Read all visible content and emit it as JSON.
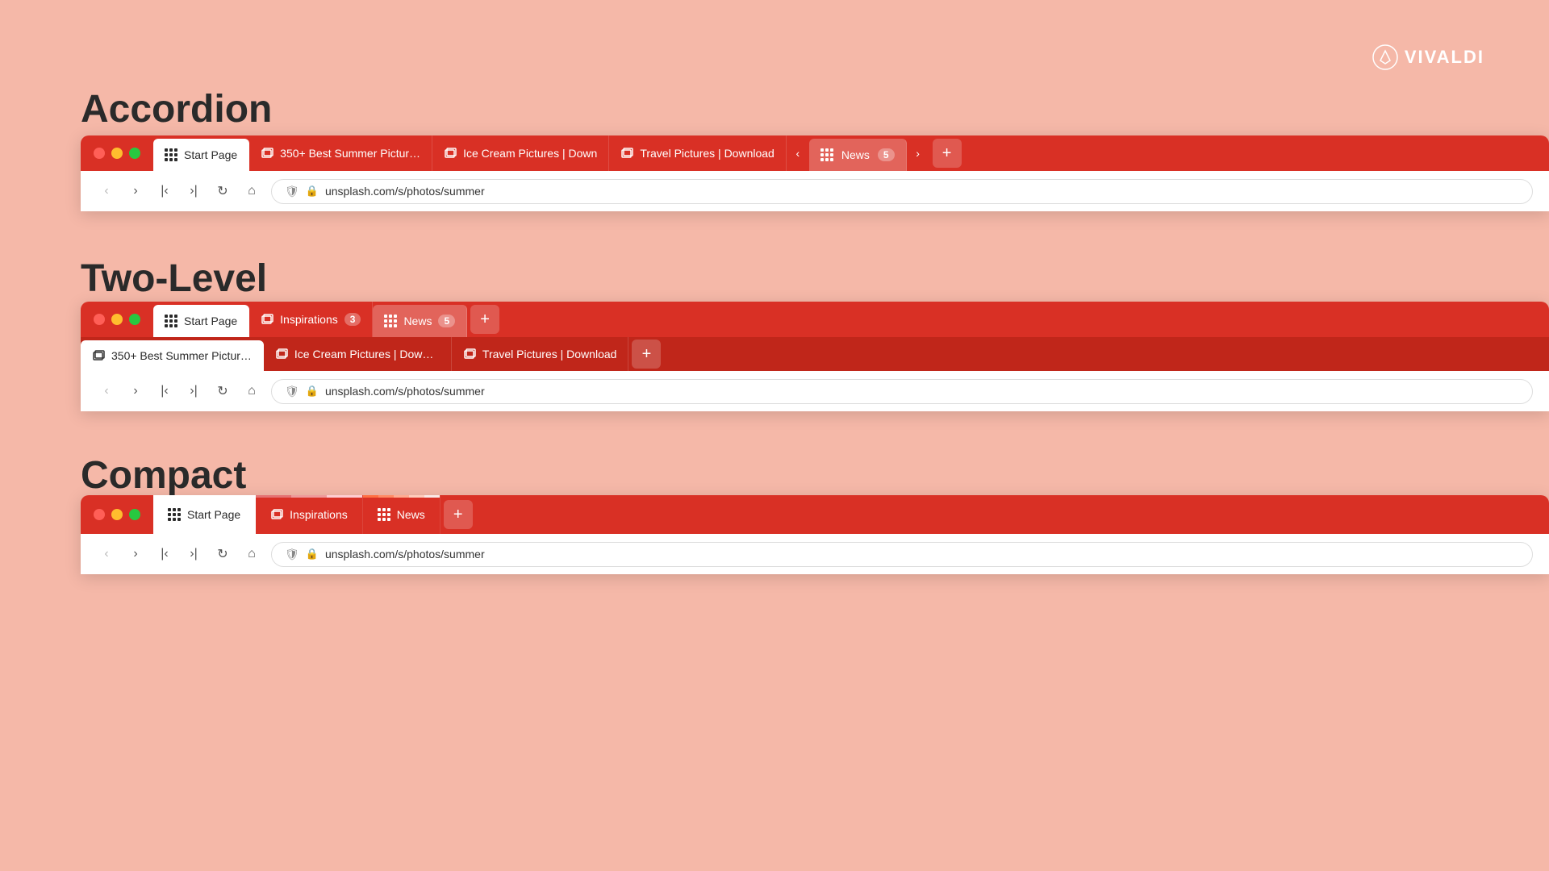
{
  "vivaldi": {
    "logo_text": "VIVALDI"
  },
  "sections": {
    "accordion": {
      "title": "Accordion",
      "tabs": [
        {
          "id": "start",
          "label": "Start Page",
          "type": "apps",
          "active": true
        },
        {
          "id": "summer",
          "label": "350+ Best Summer Pictur…",
          "type": "stack",
          "active": false
        },
        {
          "id": "icecream",
          "label": "Ice Cream Pictures | Down",
          "type": "stack",
          "active": false
        },
        {
          "id": "travel",
          "label": "Travel Pictures | Download",
          "type": "stack",
          "active": false
        }
      ],
      "group_tab": {
        "label": "News",
        "count": "5"
      },
      "url": "unsplash.com/s/photos/summer"
    },
    "twolevel": {
      "title": "Two-Level",
      "top_tabs": [
        {
          "id": "start",
          "label": "Start Page",
          "type": "apps"
        },
        {
          "id": "inspirations",
          "label": "Inspirations",
          "count": "3"
        },
        {
          "id": "news",
          "label": "News",
          "count": "5",
          "active": true
        }
      ],
      "sub_tabs": [
        {
          "id": "summer",
          "label": "350+ Best Summer Pictur…",
          "type": "stack",
          "active": true
        },
        {
          "id": "icecream",
          "label": "Ice Cream Pictures | Down…",
          "type": "stack"
        },
        {
          "id": "travel",
          "label": "Travel Pictures | Download",
          "type": "stack"
        }
      ],
      "url": "unsplash.com/s/photos/summer"
    },
    "compact": {
      "title": "Compact",
      "tabs": [
        {
          "id": "start",
          "label": "Start Page",
          "type": "apps"
        },
        {
          "id": "inspirations",
          "label": "Inspirations"
        },
        {
          "id": "news",
          "label": "News"
        }
      ],
      "url": "unsplash.com/s/photos/summer"
    }
  }
}
